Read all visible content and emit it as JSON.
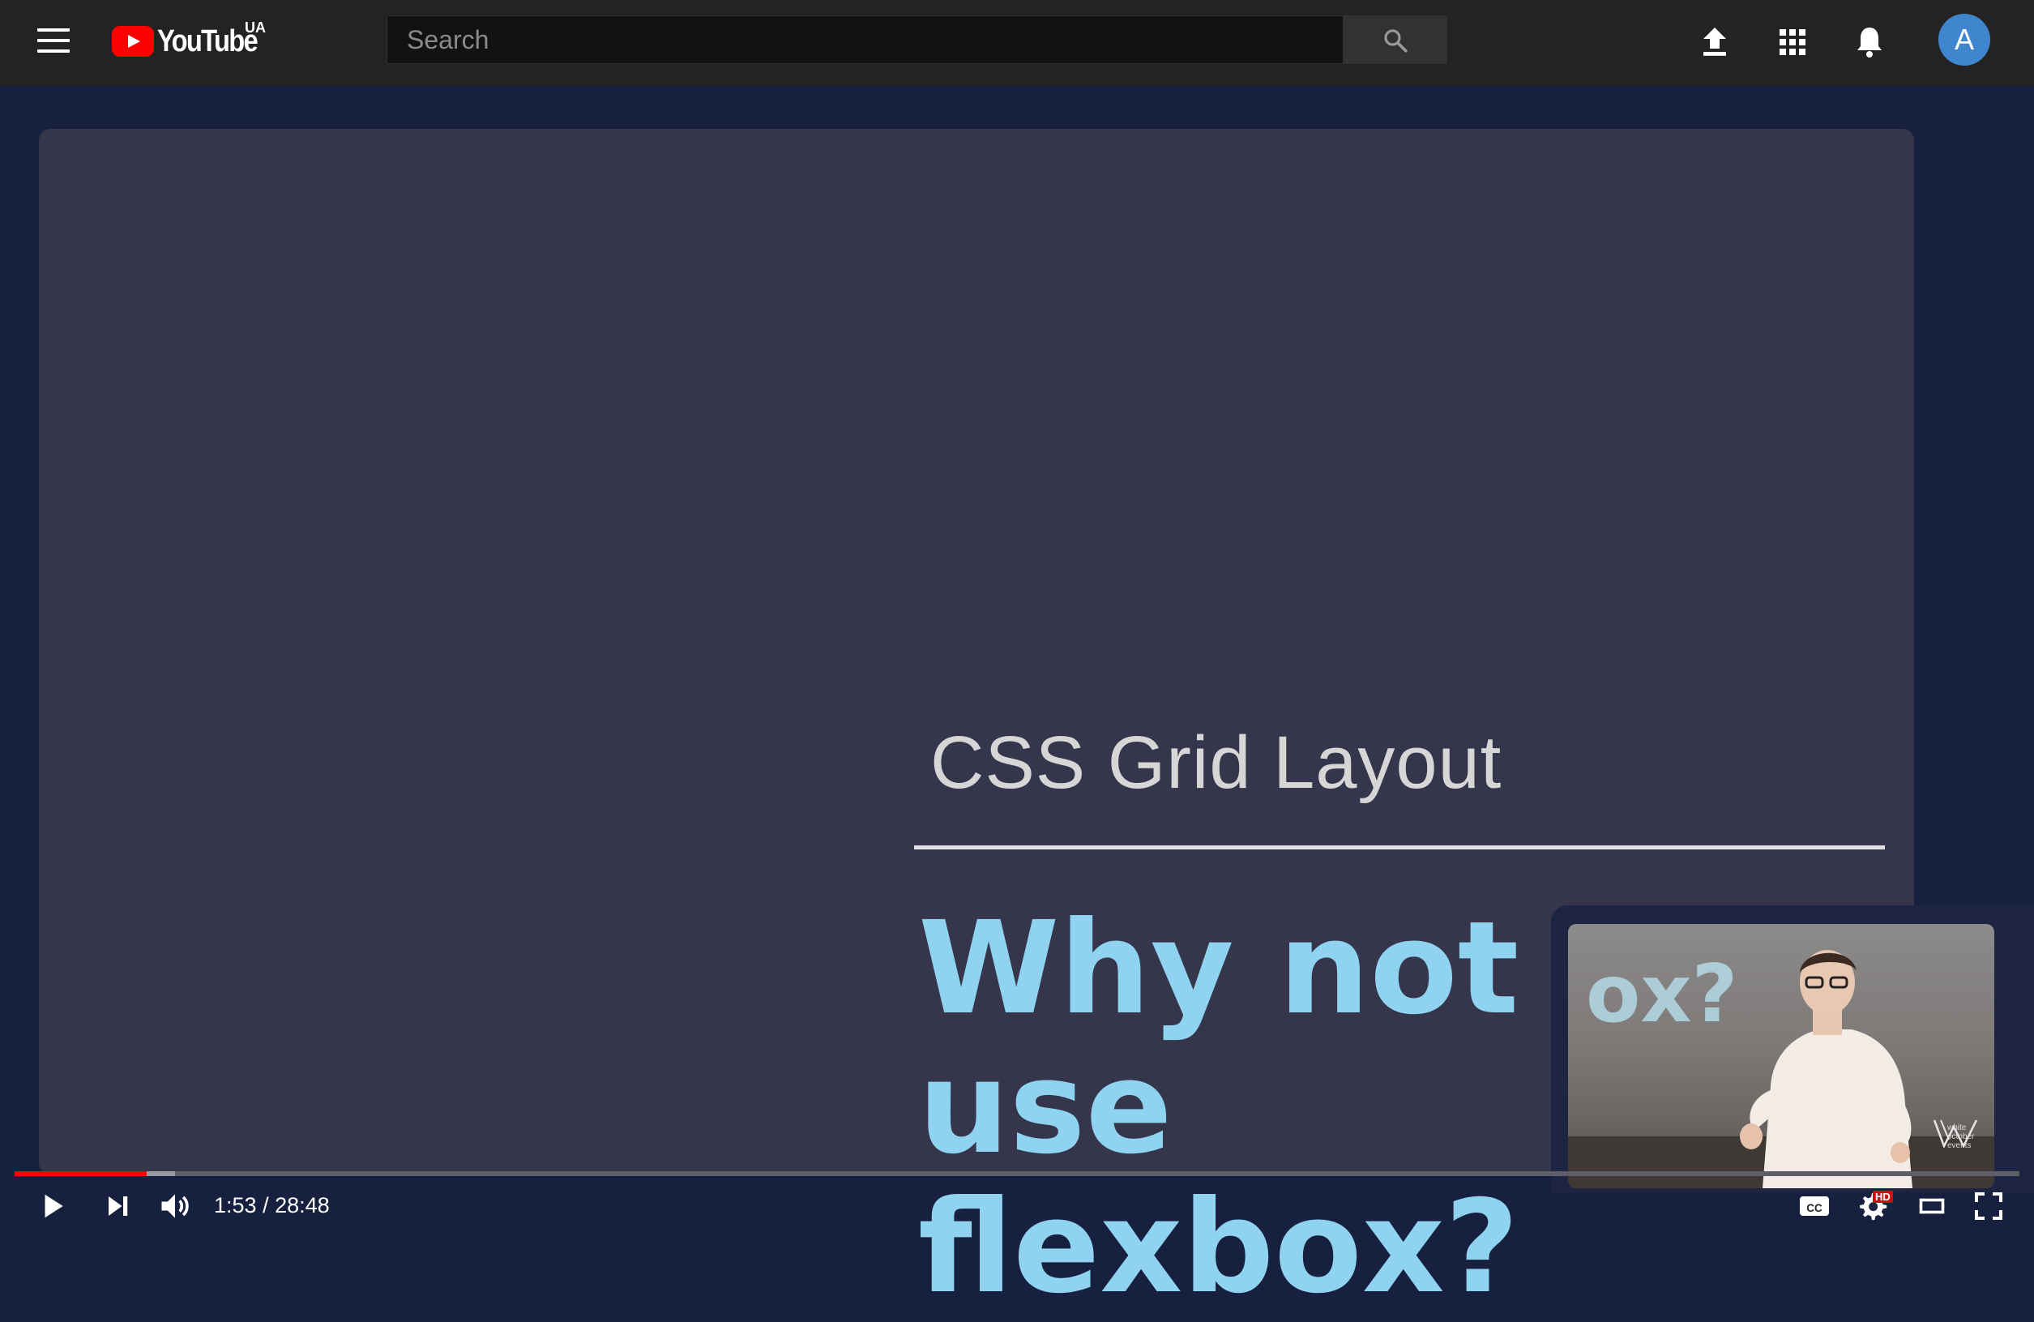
{
  "header": {
    "menu_icon": "hamburger-menu-icon",
    "logo_text": "YouTube",
    "country_code": "UA",
    "search": {
      "placeholder": "Search",
      "value": ""
    },
    "icons": [
      "upload-icon",
      "apps-grid-icon",
      "notifications-bell-icon",
      "search-icon"
    ],
    "avatar_letter": "A"
  },
  "video": {
    "slide_title": "CSS Grid Layout",
    "slide_question": "Why not use flexbox?",
    "pip_overlay_text": "ox?",
    "pip_watermark": "white october events"
  },
  "player": {
    "current_time": "1:53",
    "duration": "28:48",
    "time_separator": " / ",
    "played_fraction": 0.066,
    "buffered_fraction": 0.08,
    "hd_badge": "HD",
    "controls": [
      "play-icon",
      "next-icon",
      "volume-icon",
      "captions-icon",
      "settings-icon",
      "theater-mode-icon",
      "fullscreen-icon"
    ]
  },
  "colors": {
    "progress_played": "#ff0000",
    "logo_red": "#ff0000",
    "avatar_bg": "#3f86cf",
    "slide_text_blue": "#8fd3f1",
    "page_bg": "#17213f"
  }
}
